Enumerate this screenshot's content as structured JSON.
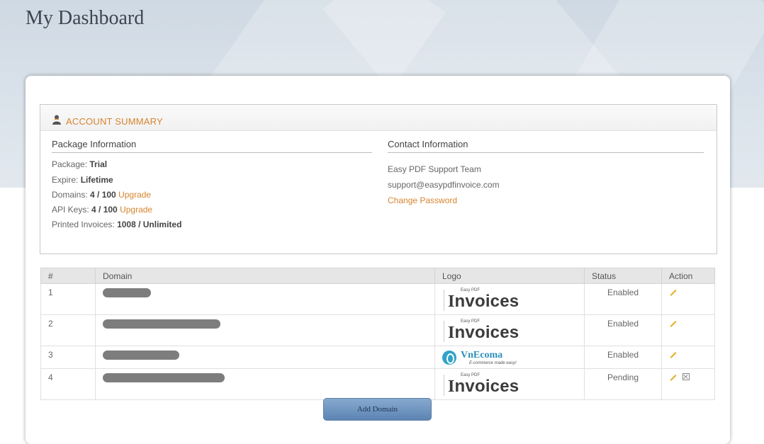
{
  "page": {
    "title": "My Dashboard"
  },
  "account_summary": {
    "title": "ACCOUNT SUMMARY",
    "package": {
      "heading": "Package Information",
      "package_label": "Package:",
      "package_value": "Trial",
      "expire_label": "Expire:",
      "expire_value": "Lifetime",
      "domains_label": "Domains:",
      "domains_value": "4 / 100",
      "domains_upgrade": "Upgrade",
      "api_label": "API Keys:",
      "api_value": "4 / 100",
      "api_upgrade": "Upgrade",
      "printed_label": "Printed Invoices:",
      "printed_value": "1008 / Unlimited"
    },
    "contact": {
      "heading": "Contact Information",
      "team": "Easy PDF Support Team",
      "email": "support@easypdfinvoice.com",
      "change_password": "Change Password"
    }
  },
  "domains_table": {
    "headers": {
      "num": "#",
      "domain": "Domain",
      "logo": "Logo",
      "status": "Status",
      "action": "Action"
    },
    "rows": [
      {
        "num": "1",
        "status": "Enabled",
        "logo": {
          "small": "Easy PDF",
          "big_cap": "I",
          "big_rest": "nvoices"
        }
      },
      {
        "num": "2",
        "status": "Enabled",
        "logo": {
          "small": "Easy PDF",
          "big_cap": "I",
          "big_rest": "nvoices"
        }
      },
      {
        "num": "3",
        "status": "Enabled",
        "logo": {
          "name": "VnEcoma",
          "tagline": "E-commerce made easy!"
        }
      },
      {
        "num": "4",
        "status": "Pending",
        "logo": {
          "small": "Easy PDF",
          "big_cap": "I",
          "big_rest": "nvoices"
        }
      }
    ]
  },
  "add_domain_label": "Add Domain",
  "icons": {
    "account": "user-icon",
    "edit": "pencil-icon",
    "delete": "close-box-icon"
  },
  "colors": {
    "accent": "#d7842f",
    "button": "#6a90bd",
    "hero": "#d5dee7"
  }
}
